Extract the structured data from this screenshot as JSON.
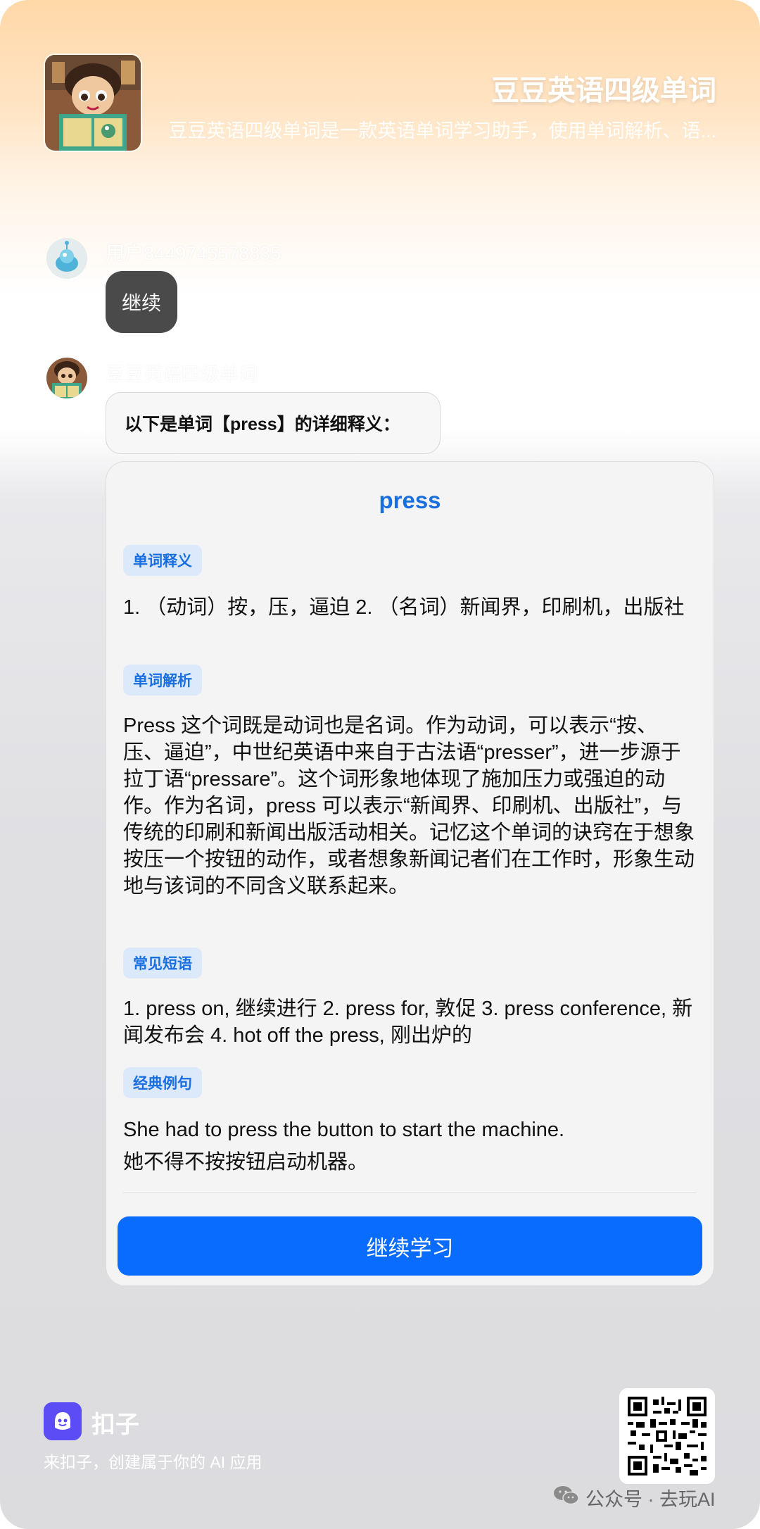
{
  "header": {
    "title": "豆豆英语四级单词",
    "description": "豆豆英语四级单词是一款英语单词学习助手，使用单词解析、语..."
  },
  "user_message": {
    "name": "用户8449745578835",
    "text": "继续"
  },
  "bot_message": {
    "name": "豆豆英语四级单词",
    "intro": "以下是单词【press】的详细释义："
  },
  "card": {
    "word": "press",
    "sections": [
      {
        "tag": "单词释义",
        "text": "1. （动词）按，压，逼迫 2. （名词）新闻界，印刷机，出版社"
      },
      {
        "tag": "单词解析",
        "text": "Press 这个词既是动词也是名词。作为动词，可以表示“按、压、逼迫”，中世纪英语中来自于古法语“presser”，进一步源于拉丁语“pressare”。这个词形象地体现了施加压力或强迫的动作。作为名词，press 可以表示“新闻界、印刷机、出版社”，与传统的印刷和新闻出版活动相关。记忆这个单词的诀窍在于想象按压一个按钮的动作，或者想象新闻记者们在工作时，形象生动地与该词的不同含义联系起来。"
      },
      {
        "tag": "常见短语",
        "text": "1. press on, 继续进行 2. press for, 敦促 3. press conference, 新闻发布会 4. hot off the press, 刚出炉的"
      },
      {
        "tag": "经典例句",
        "text_en": "She had to press the button to start the machine.",
        "text_zh": "她不得不按按钮启动机器。"
      }
    ],
    "button_label": "继续学习"
  },
  "footer": {
    "brand": "扣子",
    "slogan": "来扣子，创建属于你的 AI 应用",
    "wechat": "公众号 · 去玩AI"
  },
  "colors": {
    "accent": "#0a6cff",
    "tag_bg": "#dbe9fb",
    "tag_text": "#1a6fe0",
    "user_bubble": "#4a4a4a"
  }
}
